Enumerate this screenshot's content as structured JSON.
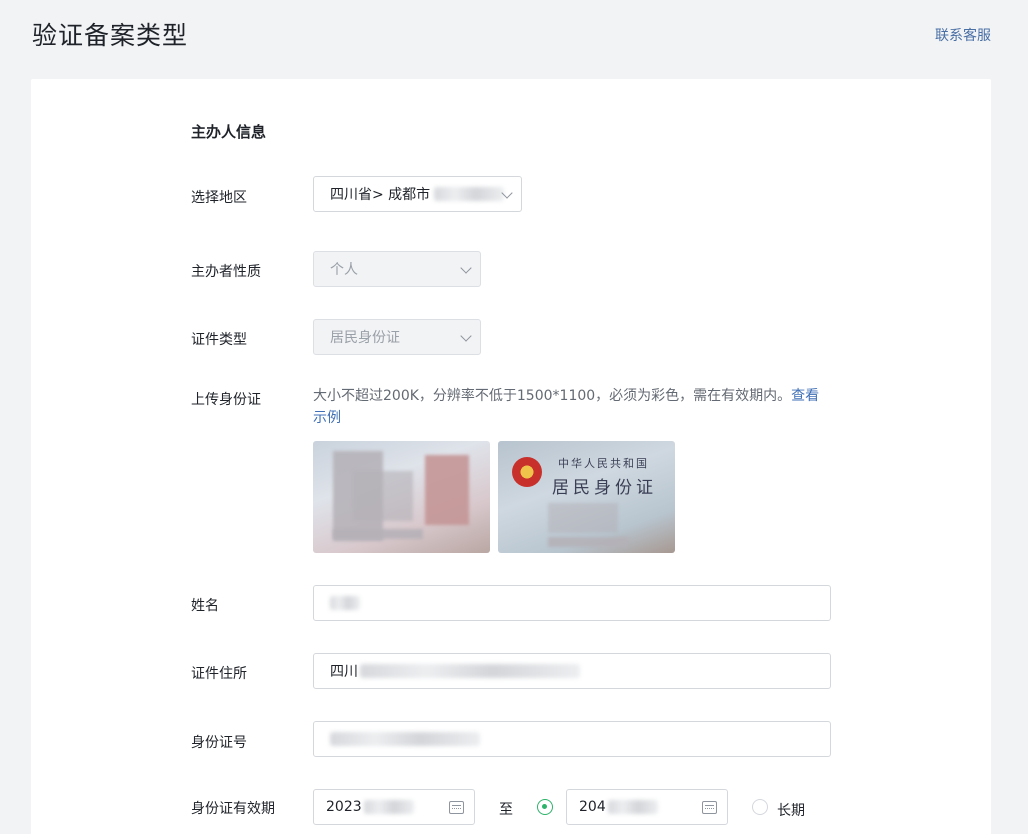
{
  "header": {
    "title": "验证备案类型",
    "contact_label": "联系客服"
  },
  "form": {
    "section_title": "主办人信息",
    "region": {
      "label": "选择地区",
      "value": "四川省> 成都市"
    },
    "organizer_type": {
      "label": "主办者性质",
      "value": "个人"
    },
    "id_type": {
      "label": "证件类型",
      "value": "居民身份证"
    },
    "upload": {
      "label": "上传身份证",
      "hint": "大小不超过200K，分辨率不低于1500*1100，必须为彩色，需在有效期内。",
      "example_link": "查看示例",
      "back_card_text": {
        "country": "中华人民共和国",
        "title": "居民身份证"
      }
    },
    "name": {
      "label": "姓名",
      "value": ""
    },
    "address": {
      "label": "证件住所",
      "value": "四川"
    },
    "id_number": {
      "label": "身份证号",
      "value": ""
    },
    "validity": {
      "label": "身份证有效期",
      "start": "2023",
      "to_label": "至",
      "end": "204",
      "long_term_label": "长期"
    }
  },
  "colors": {
    "accent_green": "#2db36a",
    "link_blue": "#3f6fb6"
  }
}
